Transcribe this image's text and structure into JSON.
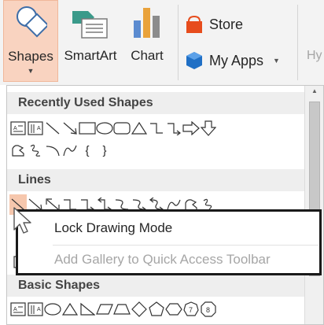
{
  "ribbon": {
    "shapes_label": "Shapes",
    "shapes_caret": "▼",
    "smartart_label": "SmartArt",
    "chart_label": "Chart",
    "store_label": "Store",
    "myapps_label": "My Apps",
    "myapps_caret": "▼",
    "truncated_label": "Hy",
    "colors": {
      "shapes_selected_bg": "#f9d3c0",
      "store_icon": "#e74c1c",
      "myapps_icon": "#1f6fc5",
      "smartart_icon": "#3a9a8a"
    }
  },
  "gallery": {
    "sections": [
      {
        "title": "Recently Used Shapes"
      },
      {
        "title": "Lines"
      },
      {
        "title": "Basic Shapes"
      }
    ],
    "recent_row1": [
      "text-box-icon",
      "vertical-text-box-icon",
      "line-icon",
      "arrow-line-icon",
      "rectangle-icon",
      "oval-icon",
      "rounded-rectangle-icon",
      "triangle-icon",
      "elbow-connector-icon",
      "elbow-arrow-connector-icon",
      "right-arrow-icon",
      "down-arrow-icon"
    ],
    "recent_row2": [
      "freeform-shape-icon",
      "scribble-icon",
      "arc-icon",
      "curve-icon",
      "left-brace-icon",
      "right-brace-icon"
    ],
    "lines_row": [
      "line-icon",
      "arrow-line-icon",
      "double-arrow-line-icon",
      "elbow-connector-icon",
      "elbow-arrow-connector-icon",
      "elbow-double-arrow-connector-icon",
      "curved-connector-icon",
      "curved-arrow-connector-icon",
      "curved-double-arrow-connector-icon",
      "curve-icon",
      "freeform-shape-icon",
      "scribble-icon"
    ],
    "basic_row": [
      "text-box-icon",
      "vertical-text-box-icon",
      "oval-icon",
      "triangle-icon",
      "right-triangle-icon",
      "parallelogram-icon",
      "trapezoid-icon",
      "diamond-icon",
      "pentagon-icon",
      "hexagon-icon",
      "heptagon-icon",
      "octagon-icon"
    ],
    "heptagon_label": "7",
    "octagon_label": "8",
    "brace_left": "{",
    "brace_right": "}",
    "scroll_up": "▲"
  },
  "context_menu": {
    "items": [
      {
        "label": "Lock Drawing Mode",
        "enabled": true
      },
      {
        "label": "Add Gallery to Quick Access Toolbar",
        "enabled": false
      }
    ],
    "colors": {
      "border": "#1a1a1a",
      "disabled_text": "#a6a6a6"
    }
  }
}
